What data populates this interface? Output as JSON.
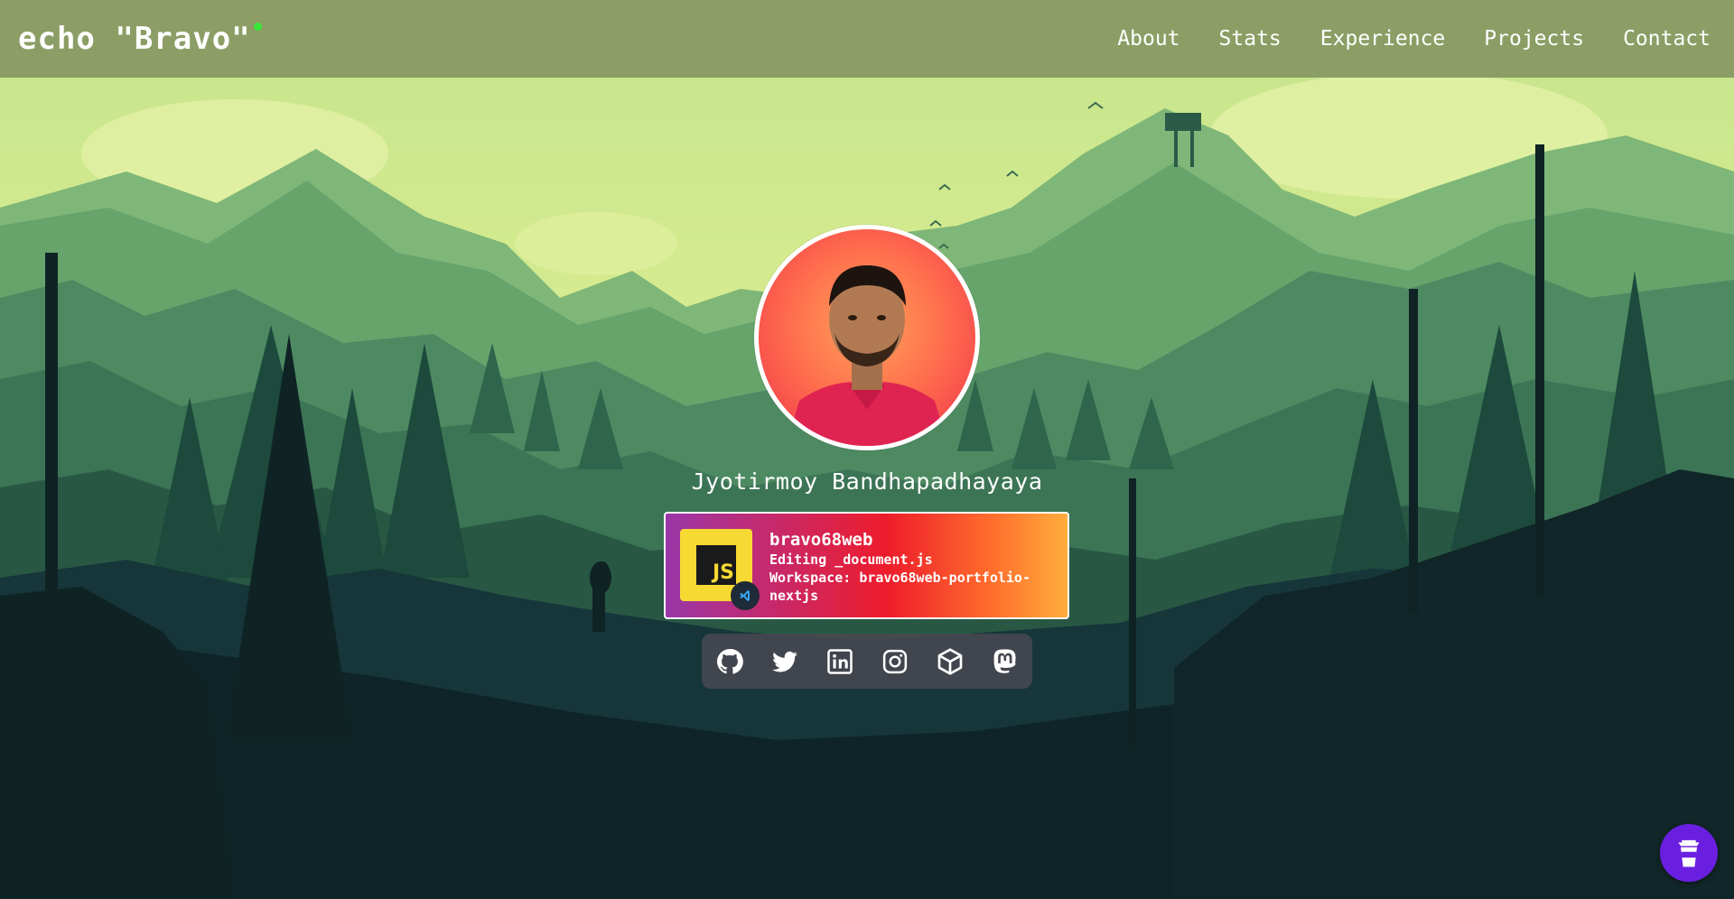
{
  "nav": {
    "brand": "echo \"Bravo\"",
    "links": [
      "About",
      "Stats",
      "Experience",
      "Projects",
      "Contact"
    ]
  },
  "profile": {
    "name": "Jyotirmoy Bandhapadhayaya"
  },
  "activity": {
    "username": "bravo68web",
    "line1": "Editing _document.js",
    "line2": "Workspace: bravo68web-portfolio-",
    "line3": "nextjs",
    "app_icon_text": "JS"
  },
  "socials": [
    {
      "name": "github-icon"
    },
    {
      "name": "twitter-icon"
    },
    {
      "name": "linkedin-icon"
    },
    {
      "name": "instagram-icon"
    },
    {
      "name": "cube-icon"
    },
    {
      "name": "mastodon-icon"
    }
  ],
  "colors": {
    "navbar": "#8c9e65",
    "brand_dot": "#39e639",
    "card_gradient_start": "#9a37a8",
    "card_gradient_end": "#ffad3c",
    "fab": "#6a1fe0"
  },
  "fab": {
    "icon": "coffee-cup-icon"
  }
}
